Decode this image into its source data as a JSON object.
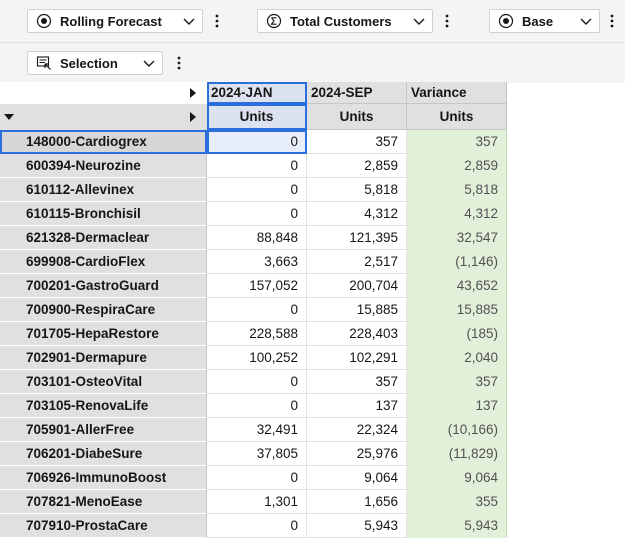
{
  "toolbar": {
    "forecast_label": "Rolling Forecast",
    "measure_label": "Total Customers",
    "scenario_label": "Base",
    "selection_label": "Selection"
  },
  "columns": {
    "row1": [
      "2024-JAN",
      "2024-SEP",
      "Variance"
    ],
    "row2": [
      "Units",
      "Units",
      "Units"
    ]
  },
  "rows": [
    {
      "label": "148000-Cardiogrex",
      "jan": "0",
      "sep": "357",
      "variance": "357"
    },
    {
      "label": "600394-Neurozine",
      "jan": "0",
      "sep": "2,859",
      "variance": "2,859"
    },
    {
      "label": "610112-Allevinex",
      "jan": "0",
      "sep": "5,818",
      "variance": "5,818"
    },
    {
      "label": "610115-Bronchisil",
      "jan": "0",
      "sep": "4,312",
      "variance": "4,312"
    },
    {
      "label": "621328-Dermaclear",
      "jan": "88,848",
      "sep": "121,395",
      "variance": "32,547"
    },
    {
      "label": "699908-CardioFlex",
      "jan": "3,663",
      "sep": "2,517",
      "variance": "(1,146)"
    },
    {
      "label": "700201-GastroGuard",
      "jan": "157,052",
      "sep": "200,704",
      "variance": "43,652"
    },
    {
      "label": "700900-RespiraCare",
      "jan": "0",
      "sep": "15,885",
      "variance": "15,885"
    },
    {
      "label": "701705-HepaRestore",
      "jan": "228,588",
      "sep": "228,403",
      "variance": "(185)"
    },
    {
      "label": "702901-Dermapure",
      "jan": "100,252",
      "sep": "102,291",
      "variance": "2,040"
    },
    {
      "label": "703101-OsteoVital",
      "jan": "0",
      "sep": "357",
      "variance": "357"
    },
    {
      "label": "703105-RenovaLife",
      "jan": "0",
      "sep": "137",
      "variance": "137"
    },
    {
      "label": "705901-AllerFree",
      "jan": "32,491",
      "sep": "22,324",
      "variance": "(10,166)"
    },
    {
      "label": "706201-DiabeSure",
      "jan": "37,805",
      "sep": "25,976",
      "variance": "(11,829)"
    },
    {
      "label": "706926-ImmunoBoost",
      "jan": "0",
      "sep": "9,064",
      "variance": "9,064"
    },
    {
      "label": "707821-MenoEase",
      "jan": "1,301",
      "sep": "1,656",
      "variance": "355"
    },
    {
      "label": "707910-ProstaCare",
      "jan": "0",
      "sep": "5,943",
      "variance": "5,943"
    }
  ],
  "colors": {
    "header_bg": "#e0e0e0",
    "variance_bg": "#e2efd9",
    "selection_border": "#2a6fdb"
  }
}
